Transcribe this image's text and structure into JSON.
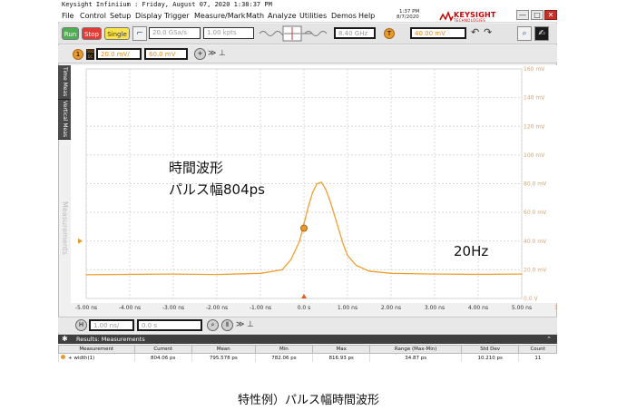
{
  "window": {
    "title": "Keysight Infiniium : Friday, August 07, 2020 1:38:37 PM",
    "clock_time": "1:37 PM",
    "clock_date": "8/7/2020",
    "brand_name": "KEYSIGHT",
    "brand_sub": "TECHNOLOGIES",
    "minimize": "—",
    "maximize": "□",
    "close": "✕"
  },
  "menu": [
    "File",
    "Control",
    "Setup",
    "Display",
    "Trigger",
    "Measure/Mark",
    "Math",
    "Analyze",
    "Utilities",
    "Demos",
    "Help"
  ],
  "toolbar": {
    "run": "Run",
    "stop": "Stop",
    "single": "Single",
    "sample_rate": "20.0 GSa/s",
    "memory_depth": "1.00 kpts",
    "bandwidth": "8.40 GHz",
    "trigger_badge": "T",
    "trigger_level": "40.00 mV"
  },
  "channel": {
    "badge": "1",
    "coupling_top": "50Ω",
    "coupling_bottom": "DC",
    "scale": "20.0 mV/",
    "offset": "60.0 mV"
  },
  "side_tabs": {
    "time_meas": "Time Meas",
    "vertical_meas": "Vertical Meas",
    "measurements": "Measurements"
  },
  "annotations": {
    "line1": "時間波形",
    "line2": "パルス幅804ps",
    "freq": "20Hz"
  },
  "axes": {
    "x_ticks": [
      "-5.00 ns",
      "-4.00 ns",
      "-3.00 ns",
      "-2.00 ns",
      "-1.00 ns",
      "0.0 s",
      "1.00 ns",
      "2.00 ns",
      "3.00 ns",
      "4.00 ns",
      "5.00 ns"
    ],
    "y_ticks": [
      "160 mV",
      "140 mV",
      "120 mV",
      "100 mV",
      "80.0 mV",
      "60.0 mV",
      "40.0 mV",
      "20.0 mV",
      "0.0 V"
    ],
    "channel_marker": "1"
  },
  "timebar": {
    "h_badge": "H",
    "scale": "1.00 ns/",
    "position": "0.0 s"
  },
  "results": {
    "header": "Results: Measurements",
    "columns": [
      "Measurement",
      "Current",
      "Mean",
      "Min",
      "Max",
      "Range (Max-Min)",
      "Std Dev",
      "Count"
    ],
    "rows": [
      [
        "+ width(1)",
        "804.06 ps",
        "795.578 ps",
        "782.06 ps",
        "816.93 ps",
        "34.87 ps",
        "10.210 ps",
        "11"
      ]
    ]
  },
  "caption": "特性例）パルス幅時間波形",
  "colors": {
    "trace": "#f0a030",
    "axis_label": "#e8a050",
    "grid": "#d9d9d9"
  },
  "chart_data": {
    "type": "line",
    "x_unit": "ns",
    "y_unit": "mV",
    "xlim": [
      -5,
      5
    ],
    "ylim": [
      0,
      160
    ],
    "grid": true,
    "trigger_level_mV": 40,
    "x": [
      -5.0,
      -4.0,
      -3.0,
      -2.0,
      -1.0,
      -0.5,
      -0.3,
      -0.1,
      0.0,
      0.1,
      0.2,
      0.3,
      0.4,
      0.5,
      0.6,
      0.7,
      0.8,
      0.9,
      1.0,
      1.2,
      1.5,
      2.0,
      3.0,
      4.0,
      5.0
    ],
    "y": [
      16.5,
      16.8,
      17.0,
      16.7,
      17.5,
      20.0,
      27.0,
      40.0,
      52.0,
      64.0,
      74.0,
      80.0,
      81.0,
      76.0,
      68.0,
      58.0,
      48.0,
      38.0,
      30.0,
      23.0,
      19.0,
      17.5,
      17.0,
      16.8,
      17.0
    ]
  }
}
